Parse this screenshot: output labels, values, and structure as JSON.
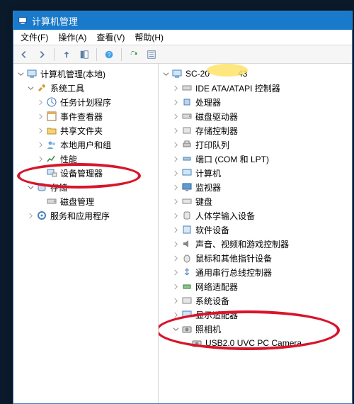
{
  "titlebar": {
    "title": "计算机管理"
  },
  "menubar": {
    "file": "文件(F)",
    "action": "操作(A)",
    "view": "查看(V)",
    "help": "帮助(H)"
  },
  "toolbar_icons": [
    "back",
    "forward",
    "up",
    "show-hide",
    "help",
    "properties",
    "refresh"
  ],
  "left_tree": {
    "root": "计算机管理(本地)",
    "sys_tools": "系统工具",
    "task_sched": "任务计划程序",
    "event_viewer": "事件查看器",
    "shared_folders": "共享文件夹",
    "local_users": "本地用户和组",
    "performance": "性能",
    "device_manager": "设备管理器",
    "storage": "存储",
    "disk_mgmt": "磁盘管理",
    "services_apps": "服务和应用程序"
  },
  "right_tree": {
    "root_prefix": "SC-20",
    "root_suffix": "43",
    "ide": "IDE ATA/ATAPI 控制器",
    "cpu": "处理器",
    "disk_drives": "磁盘驱动器",
    "storage_ctrl": "存储控制器",
    "print_queue": "打印队列",
    "ports": "端口 (COM 和 LPT)",
    "computer": "计算机",
    "monitor": "监视器",
    "keyboard": "键盘",
    "hid": "人体学输入设备",
    "software_dev": "软件设备",
    "sound": "声音、视频和游戏控制器",
    "mouse": "鼠标和其他指针设备",
    "usb_ctrl": "通用串行总线控制器",
    "network": "网络适配器",
    "sys_devices": "系统设备",
    "display": "显示适配器",
    "camera": "照相机",
    "camera_dev": "USB2.0 UVC PC Camera"
  },
  "watermark": ""
}
